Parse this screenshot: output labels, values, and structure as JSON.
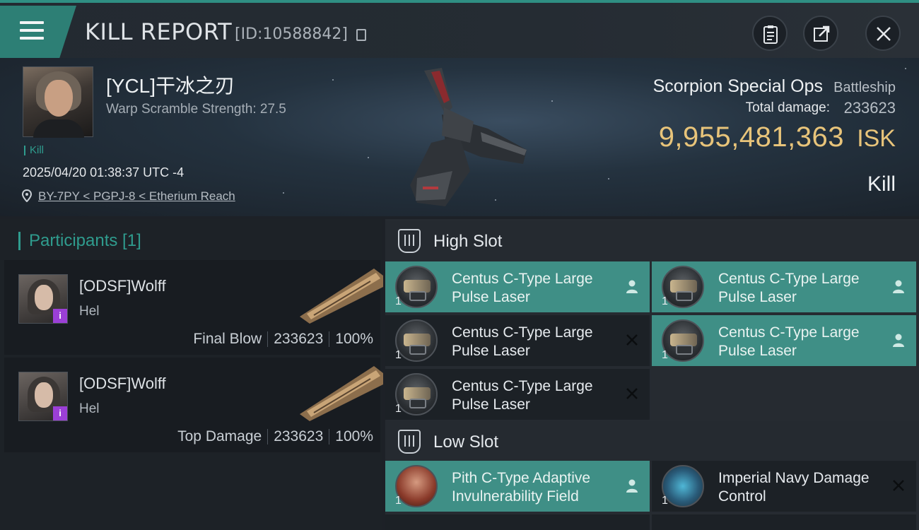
{
  "window": {
    "title": "KILL REPORT",
    "id_text": "[ID:10588842]"
  },
  "victim": {
    "name": "[YCL]干冰之刃",
    "warp_scramble": "Warp Scramble Strength: 27.5",
    "tag": "Kill",
    "datetime": "2025/04/20 01:38:37 UTC -4",
    "location": "BY-7PY < PGPJ-8 < Etherium Reach",
    "ship_name": "Scorpion Special Ops",
    "ship_class": "Battleship",
    "total_damage_label": "Total damage:",
    "total_damage_value": "233623",
    "isk_value": "9,955,481,363",
    "isk_unit": "ISK",
    "result": "Kill"
  },
  "participants": {
    "header": "Participants [1]",
    "rows": [
      {
        "name": "[ODSF]Wolff",
        "ship": "Hel",
        "role": "Final Blow",
        "damage": "233623",
        "percent": "100%",
        "badge": "i"
      },
      {
        "name": "[ODSF]Wolff",
        "ship": "Hel",
        "role": "Top Damage",
        "damage": "233623",
        "percent": "100%",
        "badge": "i"
      }
    ]
  },
  "slots": {
    "high_label": "High Slot",
    "low_label": "Low Slot",
    "high": [
      {
        "name": "Centus C-Type Large Pulse Laser",
        "qty": "1",
        "status": "dropped"
      },
      {
        "name": "Centus C-Type Large Pulse Laser",
        "qty": "1",
        "status": "dropped"
      },
      {
        "name": "Centus C-Type Large Pulse Laser",
        "qty": "1",
        "status": "destroyed"
      },
      {
        "name": "Centus C-Type Large Pulse Laser",
        "qty": "1",
        "status": "dropped"
      },
      {
        "name": "Centus C-Type Large Pulse Laser",
        "qty": "1",
        "status": "destroyed"
      }
    ],
    "low": [
      {
        "name": "Pith C-Type Adaptive Invulnerability Field",
        "qty": "1",
        "status": "dropped"
      },
      {
        "name": "Imperial Navy Damage Control",
        "qty": "1",
        "status": "destroyed"
      }
    ]
  },
  "colors": {
    "accent": "#2f9c8e",
    "isk": "#e8c47a",
    "dropped_bg": "#3f8f86",
    "destroyed_bg": "#1c2126"
  },
  "icons": [
    "menu-icon",
    "copy-icon",
    "clipboard-icon",
    "share-icon",
    "close-icon",
    "location-pin-icon",
    "slot-icon",
    "person-icon",
    "x-icon"
  ]
}
